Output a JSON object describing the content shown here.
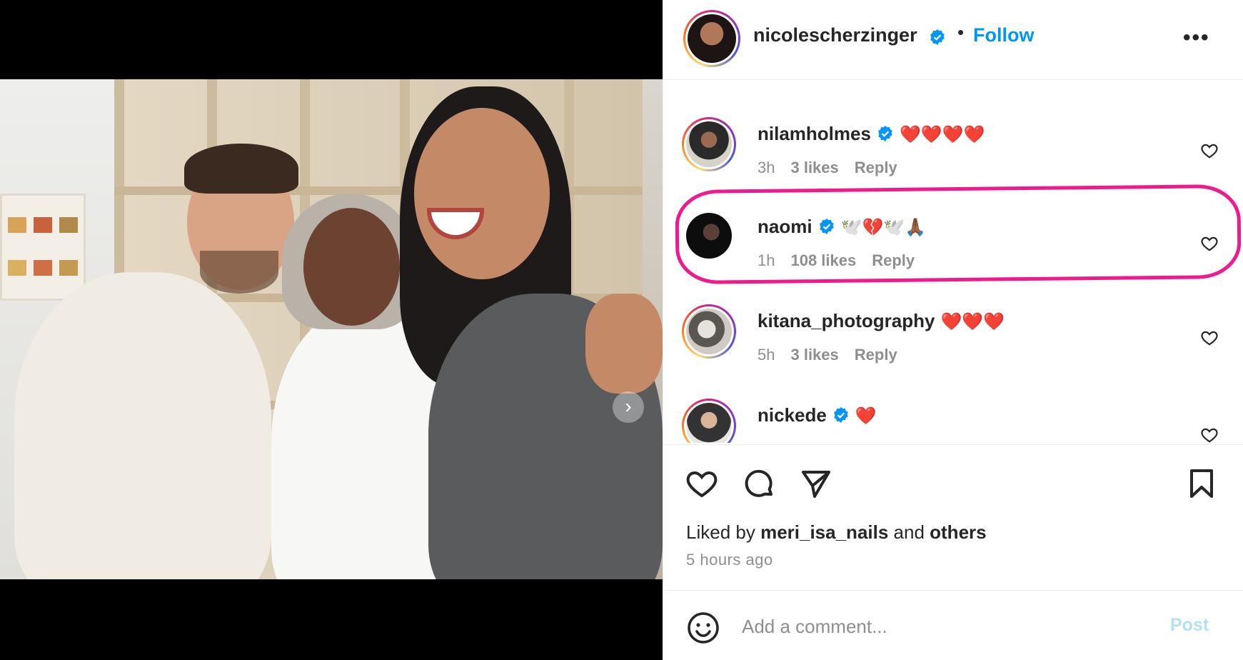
{
  "post": {
    "author": "nicolescherzinger",
    "follow_label": "Follow",
    "separator": "•",
    "more_label": "•••",
    "carousel_next": "›"
  },
  "comments": [
    {
      "username": "nilamholmes",
      "verified": true,
      "text": "❤️❤️❤️❤️",
      "time": "3h",
      "likes": "3 likes",
      "reply": "Reply"
    },
    {
      "username": "naomi",
      "verified": true,
      "text": "🕊️💔🕊️🙏🏾",
      "time": "1h",
      "likes": "108 likes",
      "reply": "Reply"
    },
    {
      "username": "kitana_photography",
      "verified": false,
      "text": "❤️❤️❤️",
      "time": "5h",
      "likes": "3 likes",
      "reply": "Reply"
    },
    {
      "username": "nickede",
      "verified": true,
      "text": "❤️",
      "time": "",
      "likes": "",
      "reply": ""
    }
  ],
  "likes_summary": {
    "prefix": "Liked by ",
    "user": "meri_isa_nails",
    "middle": " and ",
    "others": "others"
  },
  "posted_ago": "5 hours ago",
  "add_comment": {
    "placeholder": "Add a comment...",
    "post_label": "Post"
  },
  "colors": {
    "follow": "#0095f6",
    "verified": "#0095f6",
    "highlight": "#ee1b8f",
    "muted": "#8e8e8e",
    "post_disabled": "#b2dffc"
  },
  "icons": [
    "heart-icon",
    "comment-icon",
    "share-icon",
    "bookmark-icon",
    "emoji-icon",
    "verified-badge-icon",
    "more-options-icon"
  ]
}
